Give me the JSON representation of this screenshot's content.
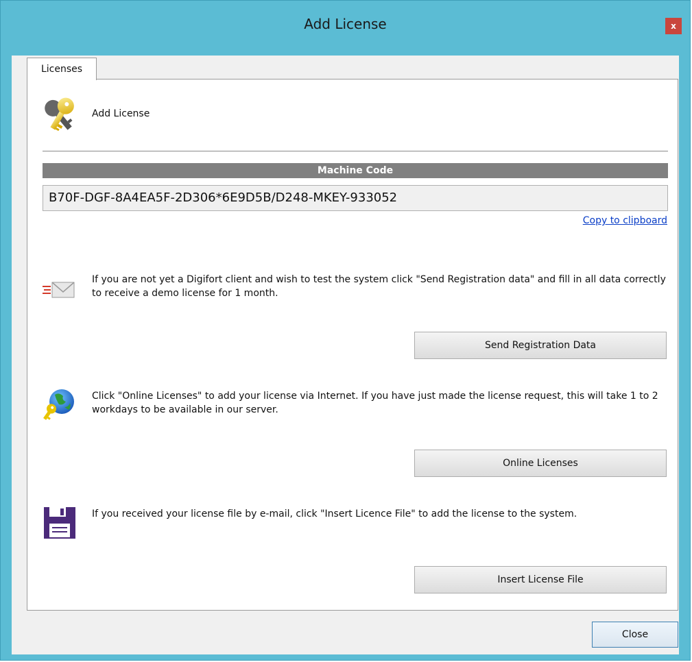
{
  "window": {
    "title": "Add License",
    "close_glyph": "x"
  },
  "tabs": [
    {
      "label": "Licenses",
      "active": true
    }
  ],
  "header": {
    "label": "Add License",
    "icon": "key-icon"
  },
  "machine_code": {
    "heading": "Machine Code",
    "value": "B70F-DGF-8A4EA5F-2D306*6E9D5B/D248-MKEY-933052",
    "copy_link": "Copy to clipboard"
  },
  "sections": [
    {
      "icon": "email-icon",
      "text": "If you are not yet a Digifort client and wish to test the system click \"Send Registration data\" and fill in all data correctly to receive a demo license for 1 month.",
      "button": "Send Registration Data"
    },
    {
      "icon": "globe-key-icon",
      "text": "Click \"Online Licenses\" to add your license via Internet. If you have just made the license request, this will take 1 to 2 workdays to be available in our server.",
      "button": "Online Licenses"
    },
    {
      "icon": "floppy-disk-icon",
      "text": "If you received your license file by e-mail, click \"Insert Licence File\" to add the license to the system.",
      "button": "Insert License File"
    }
  ],
  "footer": {
    "close_label": "Close"
  },
  "colors": {
    "titlebar": "#5bbcd4",
    "close_button": "#c9463d",
    "link": "#0a3ec7",
    "machine_code_bar": "#808080"
  }
}
